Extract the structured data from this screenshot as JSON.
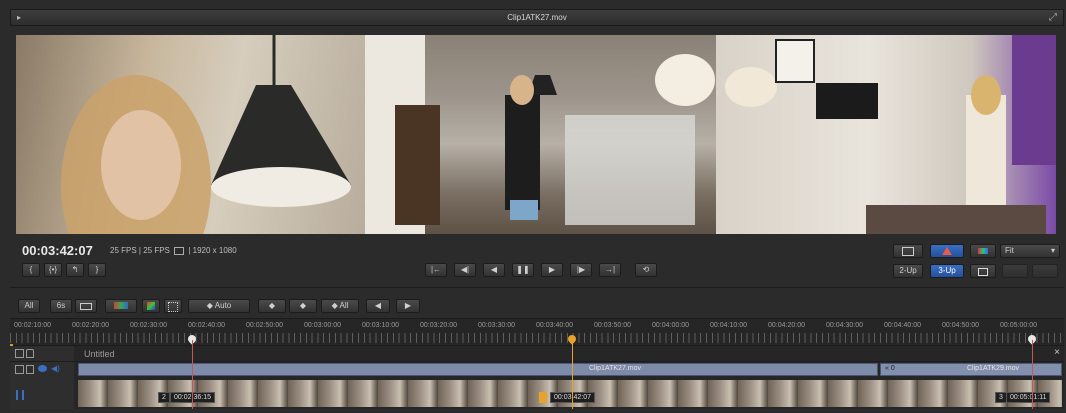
{
  "window": {
    "title": "Clip1ATK27.mov",
    "play_icon": "▸",
    "expand_icon": "⤢"
  },
  "viewer": {
    "timecode": "00:03:42:07",
    "fps_info": "25 FPS  |  25 FPS",
    "resolution": "|  1920 x 1080",
    "fit_value": "Fit",
    "layout_2up": "2-Up",
    "layout_3up": "3-Up"
  },
  "transport": {
    "mark_in": "{",
    "mark_clip": "{•}",
    "goto_in": "↰",
    "mark_out": "}",
    "goto_start": "|←",
    "prev_frame": "◀|",
    "play_reverse": "◀",
    "pause": "❚❚",
    "play_forward": "▶",
    "next_frame": "|▶",
    "goto_end": "→|",
    "loop": "⟲"
  },
  "timeline_toolbar": {
    "all": "All",
    "six_s": "6s",
    "auto": "◆ Auto",
    "add_key": "◆",
    "remove_key": "◆",
    "all_keys": "◆ All",
    "prev": "◀",
    "next": "▶"
  },
  "ruler": {
    "labels": [
      "00:02:10:00",
      "00:02:20:00",
      "00:02:30:00",
      "00:02:40:00",
      "00:02:50:00",
      "00:03:00:00",
      "00:03:10:00",
      "00:03:20:00",
      "00:03:30:00",
      "00:03:40:00",
      "00:03:50:00",
      "00:04:00:00",
      "00:04:10:00",
      "00:04:20:00",
      "00:04:30:00",
      "00:04:40:00",
      "00:04:50:00",
      "00:05:00:00"
    ]
  },
  "tracks": {
    "sequence_name": "Untitled",
    "close_icon": "×",
    "clip1_label": "Clip1ATK27.mov",
    "clip2_label": "Clip1ATK29.mov",
    "clip2_speed": "«  0",
    "tc_left": "00:02:36:15",
    "tc_left_index": "2",
    "tc_mid": "00:03:42:07",
    "tc_right": "00:05:01:11",
    "tc_right_index": "3"
  },
  "colors": {
    "accent_blue": "#3a6fc4",
    "marker_white": "#e8e8e8",
    "marker_orange": "#e7a22b",
    "playhead": "#c9555a",
    "clip_blue": "#7d8aa8"
  }
}
